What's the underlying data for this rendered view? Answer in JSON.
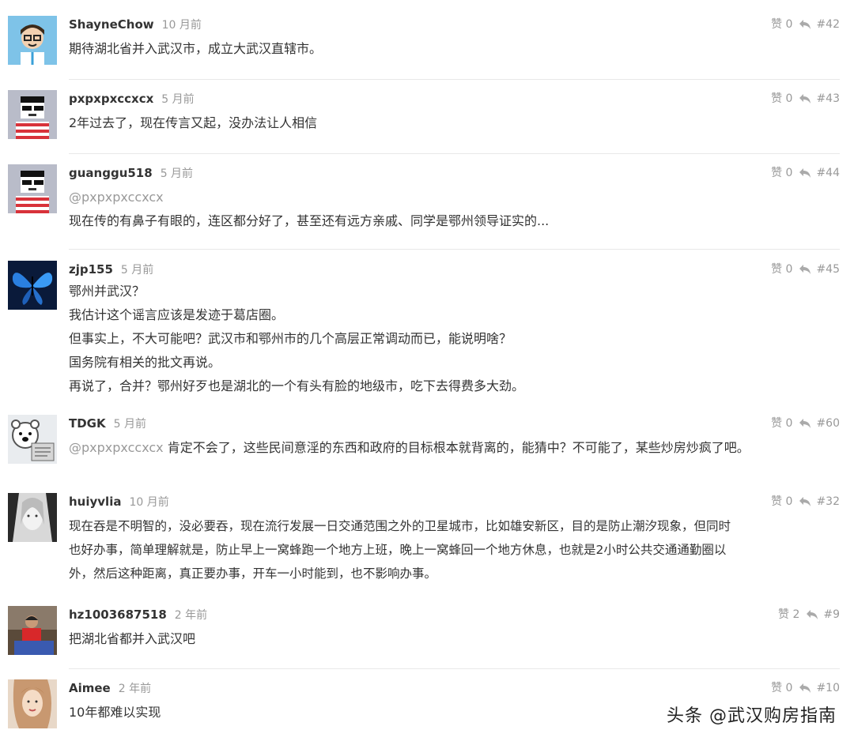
{
  "comments": [
    {
      "user": "ShayneChow",
      "time": "10 月前",
      "likes": "赞 0",
      "floor": "#42",
      "lines": [
        "期待湖北省并入武汉市，成立大武汉直辖市。"
      ],
      "mention": ""
    },
    {
      "user": "pxpxpxccxcx",
      "time": "5 月前",
      "likes": "赞 0",
      "floor": "#43",
      "lines": [
        "2年过去了，现在传言又起，没办法让人相信"
      ],
      "mention": ""
    },
    {
      "user": "guanggu518",
      "time": "5 月前",
      "likes": "赞 0",
      "floor": "#44",
      "mention": "@pxpxpxccxcx",
      "lines": [
        "现在传的有鼻子有眼的，连区都分好了，甚至还有远方亲戚、同学是鄂州领导证实的..."
      ]
    },
    {
      "user": "zjp155",
      "time": "5 月前",
      "likes": "赞 0",
      "floor": "#45",
      "mention": "",
      "lines": [
        "鄂州并武汉？",
        "我估计这个谣言应该是发迹于葛店圈。",
        "但事实上，不大可能吧？武汉市和鄂州市的几个高层正常调动而已，能说明啥？",
        "国务院有相关的批文再说。",
        "再说了，合并？鄂州好歹也是湖北的一个有头有脸的地级市，吃下去得费多大劲。"
      ]
    },
    {
      "user": "TDGK",
      "time": "5 月前",
      "likes": "赞 0",
      "floor": "#60",
      "mention": "@pxpxpxccxcx",
      "inline_text": " 肯定不会了，这些民间意淫的东西和政府的目标根本就背离的，能猜中？不可能了，某些炒房炒疯了吧。",
      "lines": []
    },
    {
      "user": "huiyvlia",
      "time": "10 月前",
      "likes": "赞 0",
      "floor": "#32",
      "mention": "",
      "lines": [
        "现在吞是不明智的，没必要吞，现在流行发展一日交通范围之外的卫星城市，比如雄安新区，目的是防止潮汐现象，但同时",
        "也好办事，简单理解就是，防止早上一窝蜂跑一个地方上班，晚上一窝蜂回一个地方休息，也就是2小时公共交通通勤圈以",
        "外，然后这种距离，真正要办事，开车一小时能到，也不影响办事。"
      ]
    },
    {
      "user": "hz1003687518",
      "time": "2 年前",
      "likes": "赞 2",
      "floor": "#9",
      "mention": "",
      "lines": [
        "把湖北省都并入武汉吧"
      ]
    },
    {
      "user": "Aimee",
      "time": "2 年前",
      "likes": "赞 0",
      "floor": "#10",
      "mention": "",
      "lines": [
        "10年都难以实现"
      ]
    }
  ],
  "watermark": "头条 @武汉购房指南"
}
